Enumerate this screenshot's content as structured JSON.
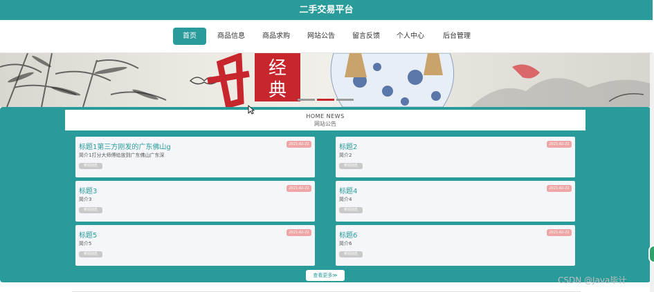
{
  "header": {
    "title": "二手交易平台"
  },
  "nav": {
    "items": [
      {
        "label": "首页"
      },
      {
        "label": "商品信息"
      },
      {
        "label": "商品求购"
      },
      {
        "label": "网站公告"
      },
      {
        "label": "留言反馈"
      },
      {
        "label": "个人中心"
      },
      {
        "label": "后台管理"
      }
    ]
  },
  "banner": {
    "calligraphy": "经典"
  },
  "news": {
    "heading_en": "HOME NEWS",
    "heading_zh": "网站公告",
    "cards": [
      {
        "title": "标题1第三方刚发的广东佛山g",
        "desc": "简介1打分大师傅给放到广东佛山广东深",
        "date": "2021-02-22",
        "tag": "新闻动态"
      },
      {
        "title": "标题2",
        "desc": "简介2",
        "date": "2021-02-22",
        "tag": "新闻动态"
      },
      {
        "title": "标题3",
        "desc": "简介3",
        "date": "2021-02-22",
        "tag": "新闻动态"
      },
      {
        "title": "标题4",
        "desc": "简介4",
        "date": "2021-02-22",
        "tag": "新闻动态"
      },
      {
        "title": "标题5",
        "desc": "简介5",
        "date": "2021-02-22",
        "tag": "新闻动态"
      },
      {
        "title": "标题6",
        "desc": "简介6",
        "date": "2021-02-22",
        "tag": "新闻动态"
      }
    ],
    "more_label": "查看更多≫"
  },
  "watermark": "CSDN @Java毕计",
  "colors": {
    "accent": "#2a9b9b",
    "date_badge": "#eea5a5",
    "card_bg": "#f4f6f9"
  }
}
